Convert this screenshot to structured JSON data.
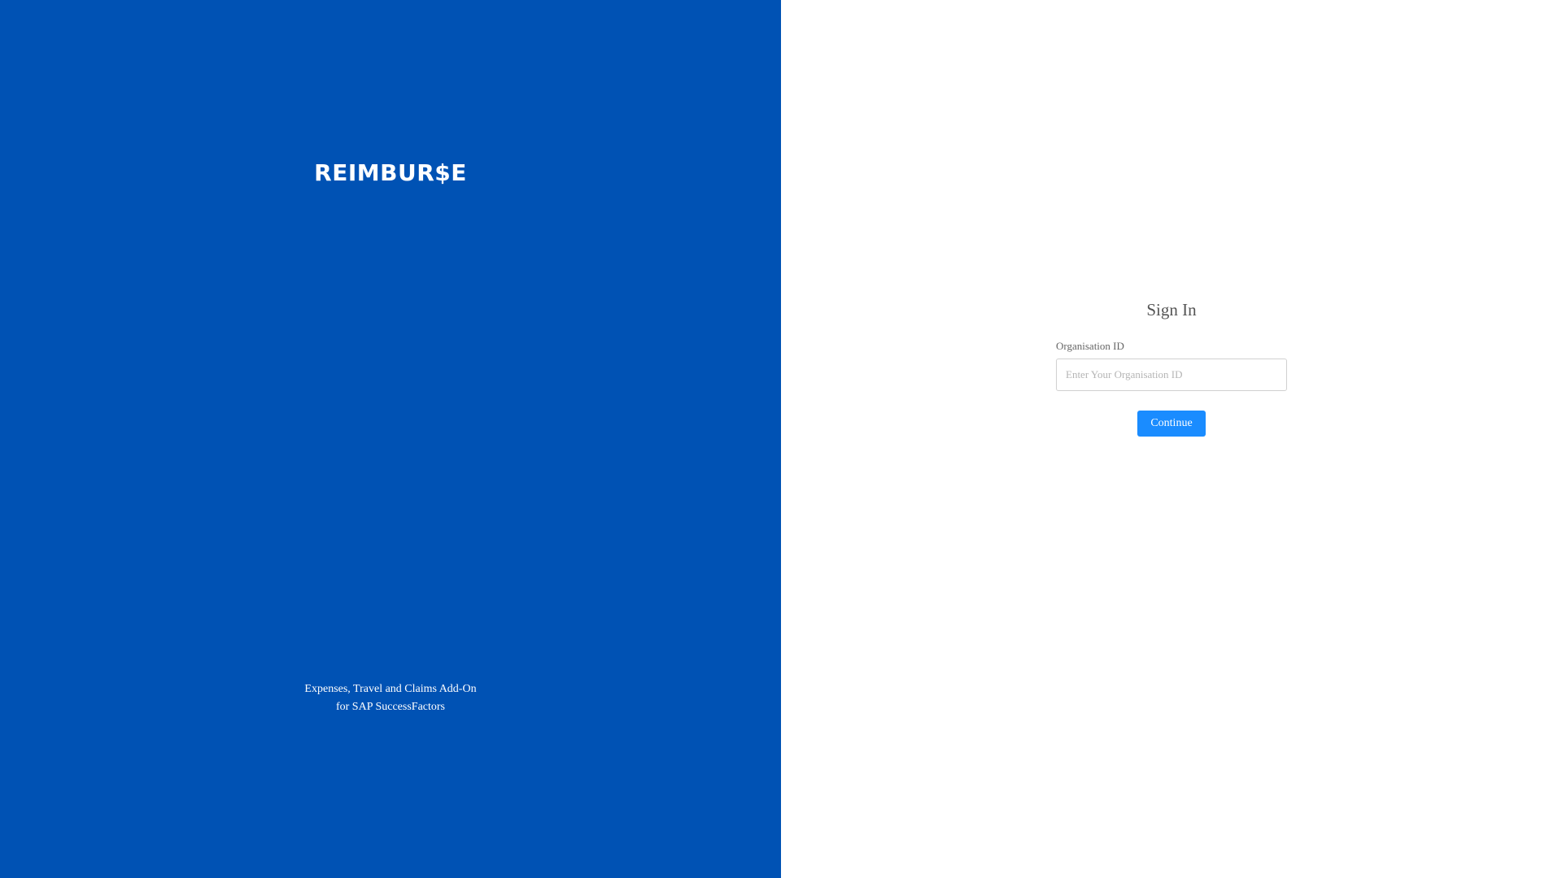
{
  "brand": {
    "logo_text": "REIMBUR$E",
    "panel_color": "#0052b4",
    "tagline_line1": "Expenses, Travel and Claims Add-On",
    "tagline_line2": "for SAP SuccessFactors"
  },
  "signin": {
    "title": "Sign In",
    "org_label": "Organisation ID",
    "org_placeholder": "Enter Your Organisation ID",
    "org_value": "",
    "continue_label": "Continue",
    "accent_color": "#1a8cff"
  }
}
